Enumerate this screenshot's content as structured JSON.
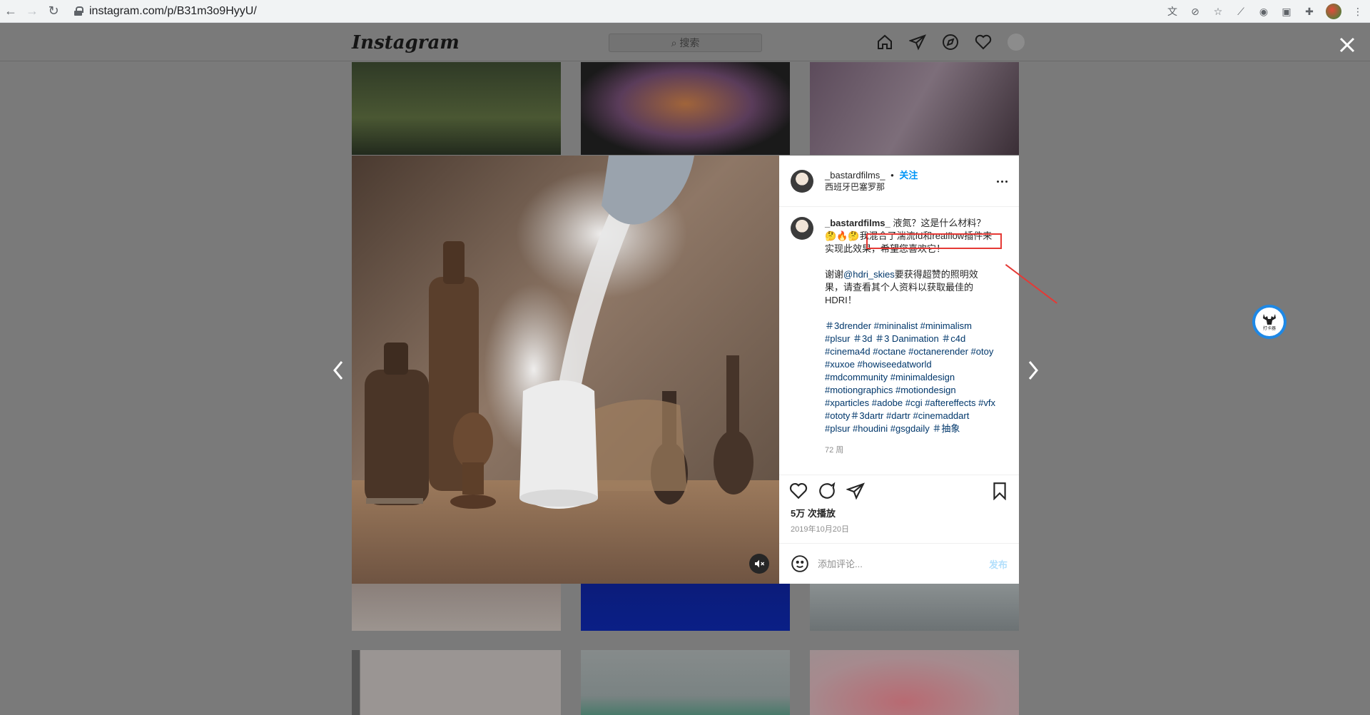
{
  "browser": {
    "url": "instagram.com/p/B31m3o9HyyU/"
  },
  "instagram": {
    "logo": "Instagram",
    "search_placeholder": "搜索"
  },
  "post": {
    "username": "_bastardfilms_",
    "follow_label": "关注",
    "location": "西班牙巴塞罗那",
    "caption_line1": "液氮？这是什么材料？",
    "caption_emoji": "🤔🔥🤔",
    "caption_highlight": "我混合了湍流fd和realflow插",
    "caption_line2": "件来实现此效果，希望您喜欢它！",
    "caption_thanks_prefix": "谢谢",
    "caption_mention": "@hdri_skies",
    "caption_thanks_suffix": "要获得超赞的照明效果，请查看其个人资料以获取最佳的HDRI！",
    "hashtags": "＃3drender #mininalist #minimalism #plsur ＃3d ＃3 Danimation ＃c4d #cinema4d #octane #octanerender #otoy #xuxoe #howiseedatworld #mdcommunity #minimaldesign #motiongraphics #motiondesign #xparticles #adobe #cgi #aftereffects #vfx #ototy＃3dartr #dartr #cinemaddart #plsur #houdini #gsgdaily ＃抽象",
    "time_ago": "72 周",
    "views": "5万 次播放",
    "date": "2019年10月20日",
    "comment_placeholder": "添加评论...",
    "post_label": "发布"
  },
  "extension": {
    "label": "打卡器"
  },
  "colors": {
    "accent": "#0095f6",
    "annotation": "#e53935",
    "overlay": "#7a7a7a"
  }
}
